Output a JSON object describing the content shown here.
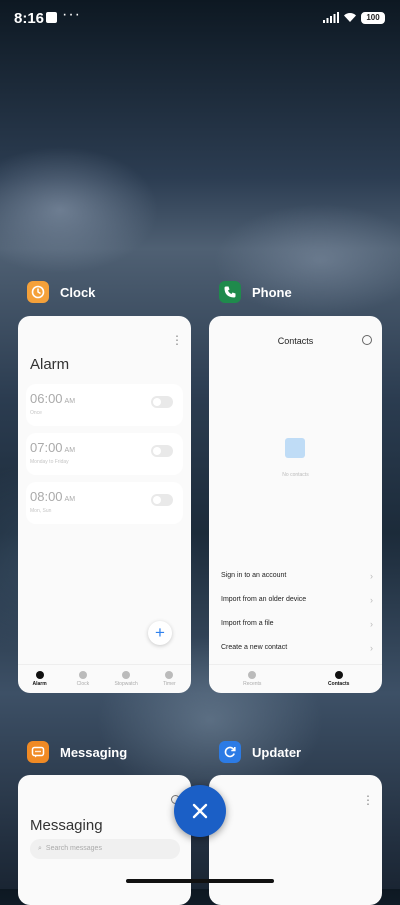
{
  "status_bar": {
    "time": "8:16",
    "more": "···",
    "battery": "100"
  },
  "apps": {
    "clock": {
      "name": "Clock",
      "icon": "clock-icon",
      "title": "Alarm",
      "alarms": [
        {
          "time": "06:00",
          "ampm": "AM",
          "label": "Once"
        },
        {
          "time": "07:00",
          "ampm": "AM",
          "label": "Monday to Friday"
        },
        {
          "time": "08:00",
          "ampm": "AM",
          "label": "Mon, Sun"
        }
      ],
      "nav": [
        "Alarm",
        "Clock",
        "Stopwatch",
        "Timer"
      ]
    },
    "phone": {
      "name": "Phone",
      "icon": "phone-icon",
      "title": "Contacts",
      "empty_text": "No contacts",
      "menu": [
        "Sign in to an account",
        "Import from an older device",
        "Import from a file",
        "Create a new contact"
      ],
      "nav": [
        "Recents",
        "Contacts"
      ]
    },
    "messaging": {
      "name": "Messaging",
      "icon": "messaging-icon",
      "title": "Messaging",
      "search_placeholder": "Search messages"
    },
    "updater": {
      "name": "Updater",
      "icon": "updater-icon"
    }
  },
  "colors": {
    "clock_icon": "#f5a13a",
    "phone_icon": "#1f8a4c",
    "messaging_icon": "#f08a24",
    "updater_icon": "#2c7be5",
    "close_button": "#1b5fc6"
  }
}
